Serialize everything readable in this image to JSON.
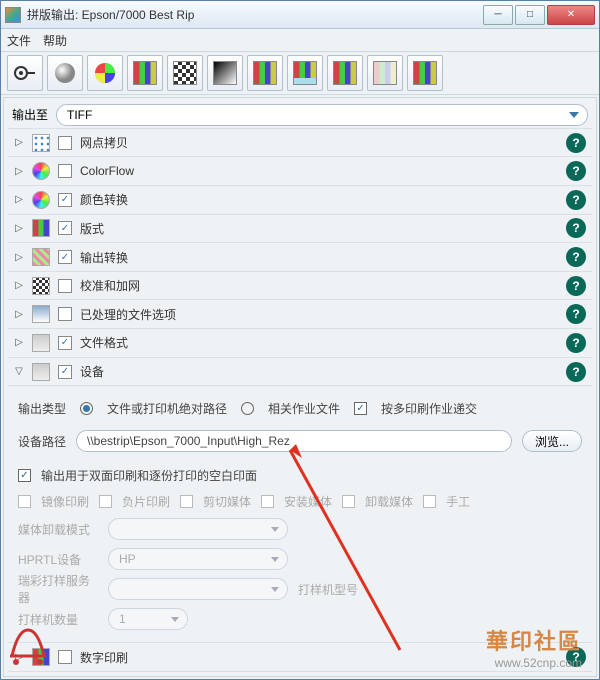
{
  "title": "拼版输出: Epson/7000 Best Rip",
  "menu": {
    "file": "文件",
    "help": "帮助"
  },
  "output": {
    "label": "输出至",
    "value": "TIFF"
  },
  "rows": [
    {
      "label": "网点拷贝",
      "checked": false
    },
    {
      "label": "ColorFlow",
      "checked": false
    },
    {
      "label": "颜色转换",
      "checked": true
    },
    {
      "label": "版式",
      "checked": true
    },
    {
      "label": "输出转换",
      "checked": true
    },
    {
      "label": "校准和加网",
      "checked": false
    },
    {
      "label": "已处理的文件选项",
      "checked": false
    },
    {
      "label": "文件格式",
      "checked": true
    },
    {
      "label": "设备",
      "checked": true,
      "expanded": true
    }
  ],
  "device": {
    "output_type_label": "输出类型",
    "radio_abs": "文件或打印机绝对路径",
    "radio_rel": "相关作业文件",
    "submit_multi": "按多印刷作业递交",
    "path_label": "设备路径",
    "path_value": "\\\\bestrip\\Epson_7000_Input\\High_Rez",
    "browse": "浏览...",
    "blank_pages": "输出用于双面印刷和逐份打印的空白印面",
    "opts": {
      "mirror": "镜像印刷",
      "neg": "负片印刷",
      "trim": "剪切媒体",
      "mount": "安装媒体",
      "unload": "卸载媒体",
      "manual": "手工"
    },
    "media_load": "媒体卸载模式",
    "hprtl": "HPRTL设备",
    "hp": "HP",
    "proof_server": "瑞彩打样服务器",
    "proof_model": "打样机型号",
    "proof_qty_label": "打样机数量",
    "proof_qty": "1",
    "digital": "数字印刷"
  },
  "watermark": {
    "name": "華印社區",
    "url": "www.52cnp.com"
  }
}
